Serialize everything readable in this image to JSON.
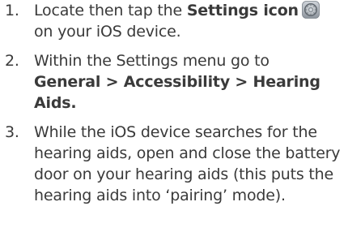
{
  "steps": [
    {
      "number": "1.",
      "before": "Locate then tap the ",
      "bold": "Settings icon",
      "after": "on your iOS device.",
      "icon": "settings-gear-icon"
    },
    {
      "number": "2.",
      "text": "Within the Settings menu go to",
      "bold_path": "General > Accessibility > Hearing Aids."
    },
    {
      "number": "3.",
      "text": "While the iOS device searches for the hearing aids, open and close the battery door on your hearing aids (this puts the hearing aids into ‘pairing’ mode)."
    }
  ]
}
